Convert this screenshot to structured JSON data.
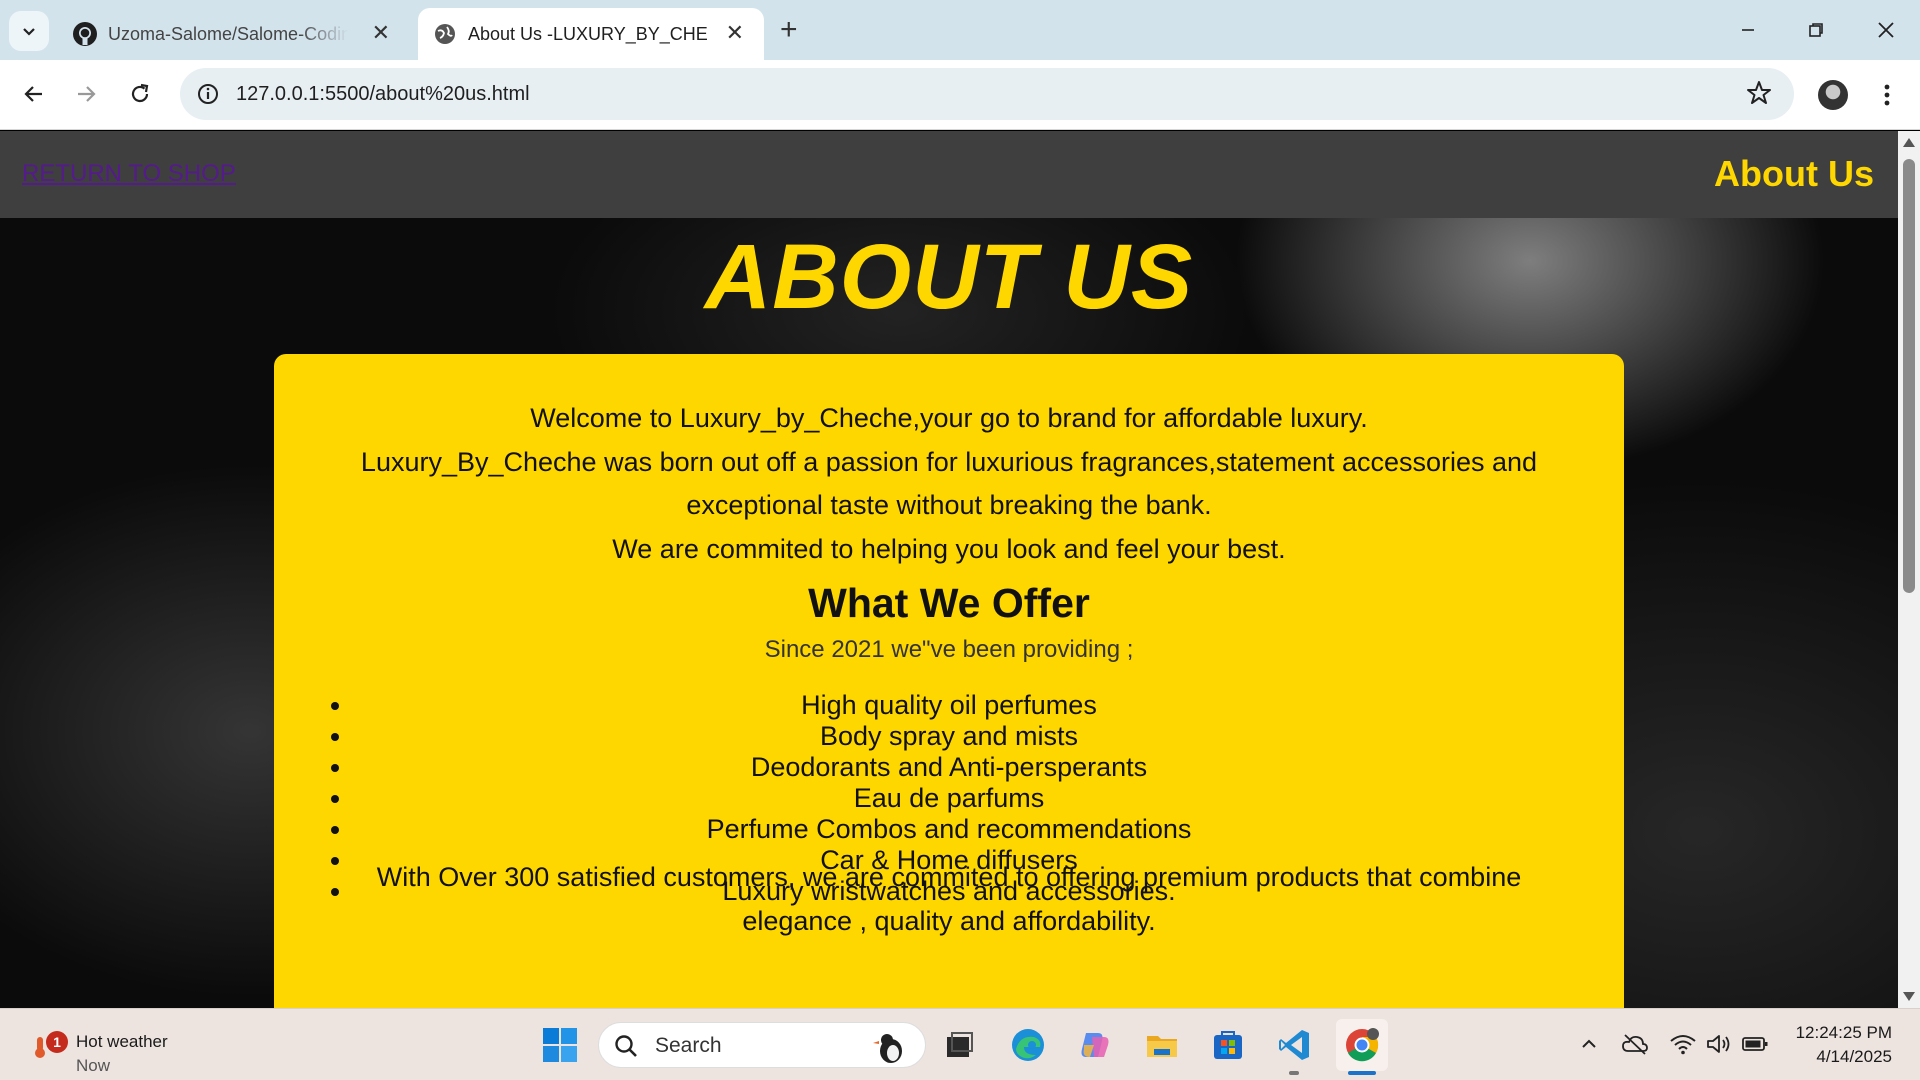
{
  "browser": {
    "tabs": [
      {
        "title": "Uzoma-Salome/Salome-Coding",
        "active": false
      },
      {
        "title": "About Us -LUXURY_BY_CHECHE",
        "active": true
      }
    ],
    "url": "127.0.0.1:5500/about%20us.html"
  },
  "page": {
    "header": {
      "return_link": "RETURN TO SHOP",
      "title": "About Us"
    },
    "hero_title": "ABOUT US",
    "intro": [
      "Welcome to Luxury_by_Cheche,your go to brand for affordable luxury.",
      "Luxury_By_Cheche was born out off a passion for luxurious fragrances,statement accessories and exceptional taste without breaking the bank.",
      "We are commited to helping you look and feel your best."
    ],
    "offer": {
      "heading": "What We Offer",
      "subheading": "Since 2021 we\"ve been providing ;",
      "items": [
        "High quality oil perfumes",
        "Body spray and mists",
        "Deodorants and Anti-persperants",
        "Eau de parfums",
        "Perfume Combos and recommendations",
        "Car & Home diffusers",
        "Luxury wristwatches and accessories."
      ]
    },
    "closing": "With Over 300 satisfied customers, we are commited to offering premium products that combine elegance , quality and affordability."
  },
  "taskbar": {
    "weather": {
      "title": "Hot weather",
      "subtitle": "Now",
      "badge": "1"
    },
    "search_placeholder": "Search",
    "time": "12:24:25 PM",
    "date": "4/14/2025"
  },
  "colors": {
    "accent_gold": "#ffd700",
    "header_gray": "#3f3f3f",
    "visited_link": "#551a8b"
  }
}
